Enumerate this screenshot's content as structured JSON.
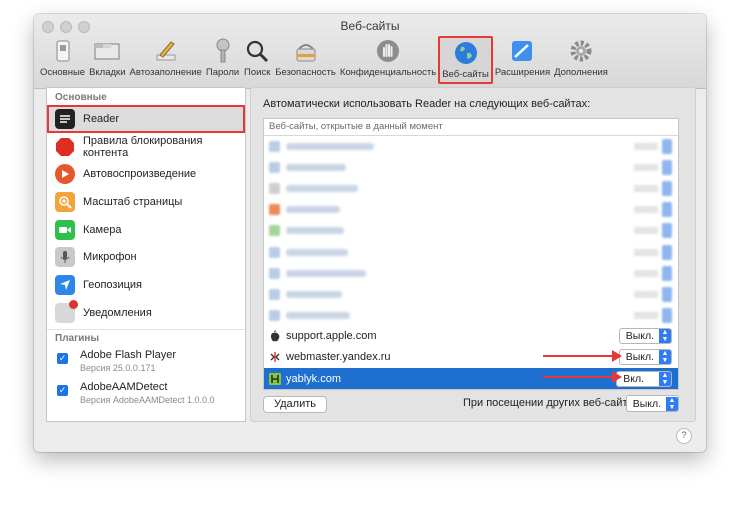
{
  "window": {
    "title": "Веб-сайты"
  },
  "toolbar": {
    "items": [
      {
        "label": "Основные",
        "icon": "switch-icon"
      },
      {
        "label": "Вкладки",
        "icon": "tabs-icon"
      },
      {
        "label": "Автозаполнение",
        "icon": "pencil-icon"
      },
      {
        "label": "Пароли",
        "icon": "key-icon"
      },
      {
        "label": "Поиск",
        "icon": "magnifier-icon"
      },
      {
        "label": "Безопасность",
        "icon": "lock-icon"
      },
      {
        "label": "Конфиденциальность",
        "icon": "hand-icon"
      },
      {
        "label": "Веб-сайты",
        "icon": "globe-icon",
        "selected": true
      },
      {
        "label": "Расширения",
        "icon": "puzzle-icon"
      },
      {
        "label": "Дополнения",
        "icon": "gear-icon"
      }
    ]
  },
  "sidebar": {
    "section_main": "Основные",
    "items": [
      {
        "label": "Reader",
        "icon": "reader-icon",
        "selected": true
      },
      {
        "label": "Правила блокирования контента",
        "icon": "stop-icon"
      },
      {
        "label": "Автовоспроизведение",
        "icon": "play-icon"
      },
      {
        "label": "Масштаб страницы",
        "icon": "zoom-icon"
      },
      {
        "label": "Камера",
        "icon": "camera-icon"
      },
      {
        "label": "Микрофон",
        "icon": "microphone-icon"
      },
      {
        "label": "Геопозиция",
        "icon": "location-icon"
      },
      {
        "label": "Уведомления",
        "icon": "notifications-icon"
      }
    ],
    "section_plugins": "Плагины",
    "plugins": [
      {
        "name": "Adobe Flash Player",
        "version": "Версия 25.0.0.171",
        "checked": true
      },
      {
        "name": "AdobeAAMDetect",
        "version": "Версия AdobeAAMDetect 1.0.0.0",
        "checked": true
      }
    ]
  },
  "main": {
    "heading": "Автоматически использовать Reader на следующих веб-сайтах:",
    "table_header": "Веб-сайты, открытые в данный момент",
    "sites": [
      {
        "name": "support.apple.com",
        "value": "Выкл.",
        "icon": "apple-icon"
      },
      {
        "name": "webmaster.yandex.ru",
        "value": "Выкл.",
        "icon": "yandex-webmaster-icon"
      },
      {
        "name": "yablyk.com",
        "value": "Вкл.",
        "icon": "yablyk-icon",
        "selected": true
      }
    ],
    "remove_button": "Удалить",
    "other_sites_label": "При посещении других веб-сайтов:",
    "other_sites_value": "Выкл."
  },
  "help": "?",
  "colors": {
    "accent": "#1f6fd0",
    "highlight_red": "#e53935"
  }
}
